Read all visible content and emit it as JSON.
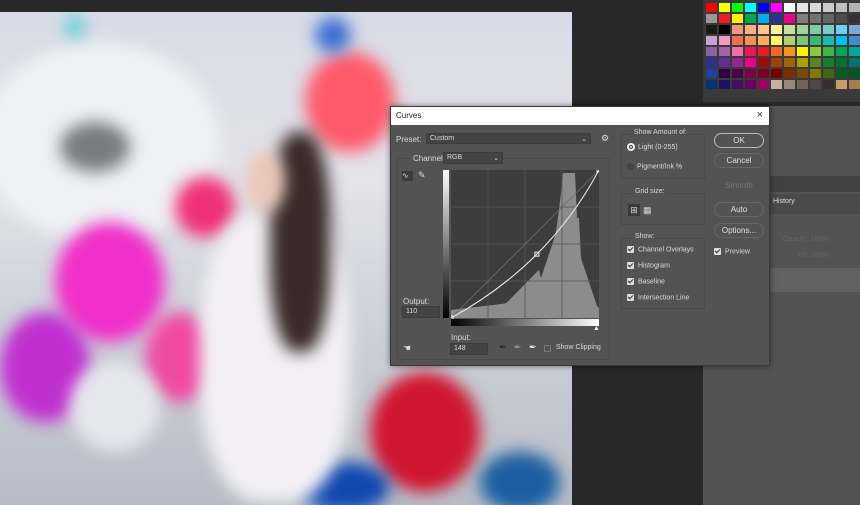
{
  "dialog": {
    "title": "Curves",
    "close": "×",
    "preset_label": "Preset:",
    "preset_value": "Custom",
    "channel_label": "Channel:",
    "channel_value": "RGB",
    "output_label": "Output:",
    "output_value": "110",
    "input_label": "Input:",
    "input_value": "148",
    "show_clipping": "Show Clipping",
    "show_amount": {
      "title": "Show Amount of:",
      "light": "Light  (0-255)",
      "pigment": "Pigment/Ink %",
      "selected": "light"
    },
    "grid_size": {
      "title": "Grid size:"
    },
    "show": {
      "title": "Show:",
      "items": [
        {
          "label": "Channel Overlays",
          "checked": true
        },
        {
          "label": "Histogram",
          "checked": true
        },
        {
          "label": "Baseline",
          "checked": true
        },
        {
          "label": "Intersection Line",
          "checked": true
        }
      ]
    },
    "buttons": {
      "ok": "OK",
      "cancel": "Cancel",
      "smooth": "Smooth",
      "auto": "Auto",
      "options": "Options..."
    },
    "preview": {
      "label": "Preview",
      "checked": true
    },
    "curve_point": {
      "input": 148,
      "output": 110
    }
  },
  "panel": {
    "tab": "History",
    "opacity_label": "Opacity:",
    "opacity_value": "100%",
    "fill_label": "Fill:",
    "fill_value": "100%"
  },
  "swatch_colors": [
    "#ff0000",
    "#ffff00",
    "#00ff00",
    "#00ffff",
    "#0000ff",
    "#ff00ff",
    "#ffffff",
    "#e6e6e6",
    "#d9d9d9",
    "#cccccc",
    "#bfbfbf",
    "#b3b3b3",
    "#999999",
    "#ed1c24",
    "#fff200",
    "#00a651",
    "#00aeef",
    "#2e3192",
    "#ec008c",
    "#808080",
    "#737373",
    "#666666",
    "#4d4d4d",
    "#333333",
    "#1a1a1a",
    "#000000",
    "#f7977a",
    "#fbad82",
    "#fdc68c",
    "#fff799",
    "#c6df9c",
    "#a4d49d",
    "#81ca9d",
    "#7bcdc9",
    "#6ccff7",
    "#7ea7d8",
    "#c9a0dc",
    "#f49ac1",
    "#f26c4f",
    "#f68e55",
    "#fbaf5c",
    "#fff467",
    "#acd372",
    "#7cc576",
    "#3bb878",
    "#1abbb4",
    "#00bff3",
    "#438ccb",
    "#8b62a8",
    "#a763a8",
    "#f06ea9",
    "#ed145b",
    "#ed1c24",
    "#f26522",
    "#f7941d",
    "#fff200",
    "#8dc63f",
    "#39b54a",
    "#00a651",
    "#00a99d",
    "#2e3192",
    "#662d91",
    "#92278f",
    "#ec008c",
    "#9e0b0f",
    "#a0410d",
    "#a3620a",
    "#aba000",
    "#598527",
    "#197b30",
    "#007236",
    "#00746b",
    "#21409a",
    "#32004b",
    "#4b0049",
    "#7b0046",
    "#7a0026",
    "#790000",
    "#7b2e00",
    "#7d4900",
    "#827b00",
    "#406618",
    "#005e20",
    "#005826",
    "#003471",
    "#1b1464",
    "#440e62",
    "#630460",
    "#9e005d",
    "#c7b299",
    "#998675",
    "#736357",
    "#534741",
    "#37302a",
    "#c69c6d",
    "#a67c52"
  ]
}
